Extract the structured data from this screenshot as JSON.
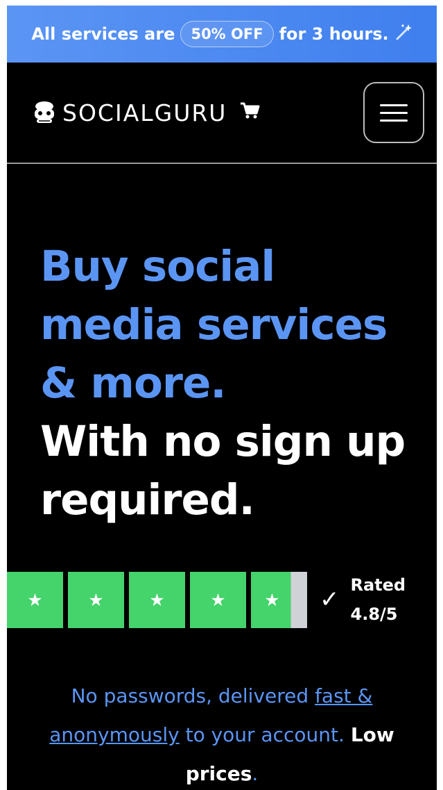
{
  "promo": {
    "text_before": "All services are",
    "badge": "50% OFF",
    "text_after": "for 3 hours.",
    "icon": "sparkle-icon"
  },
  "header": {
    "brand": "SOCIALGURU",
    "logo_icon": "guru-face-icon",
    "cart_icon": "cart-icon",
    "menu_icon": "hamburger-icon"
  },
  "hero": {
    "line1": "Buy social",
    "line2": "media services",
    "line3": "& more.",
    "line4": "With no sign up",
    "line5": "required."
  },
  "rating": {
    "stars": 4.8,
    "max": 5,
    "label_line1": "Rated",
    "label_line2": "4.8/5",
    "check_icon": "checkmark-icon"
  },
  "tagline": {
    "part1": "No passwords, delivered ",
    "link": "fast & anonymously",
    "part2": " to your account. ",
    "strong": "Low prices",
    "end": "."
  },
  "colors": {
    "accent": "#5b95f4",
    "star_green": "#45d36c",
    "background": "#000000"
  }
}
